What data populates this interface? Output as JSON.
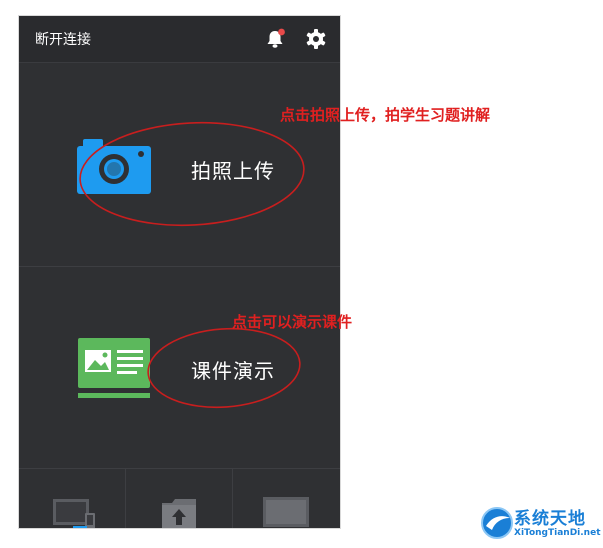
{
  "topbar": {
    "disconnect_label": "断开连接",
    "notification_icon": "bell-icon",
    "settings_icon": "gear-icon",
    "notification_dot_color": "#e84a4a"
  },
  "panels": {
    "photo": {
      "label": "拍照上传",
      "icon": "camera-icon",
      "icon_color": "#1e9bf0"
    },
    "slides": {
      "label": "课件演示",
      "icon": "slideshow-icon",
      "icon_color": "#5cb85c"
    }
  },
  "bottom_tabs": [
    {
      "icon": "devices-icon"
    },
    {
      "icon": "folder-upload-icon"
    },
    {
      "icon": "monitor-icon"
    }
  ],
  "annotations": {
    "photo_note": "点击拍照上传，拍学生习题讲解",
    "slides_note": "点击可以演示课件",
    "color": "#e02020"
  },
  "watermark": {
    "title": "系统天地",
    "subtitle": "XiTongTianDi.net"
  }
}
